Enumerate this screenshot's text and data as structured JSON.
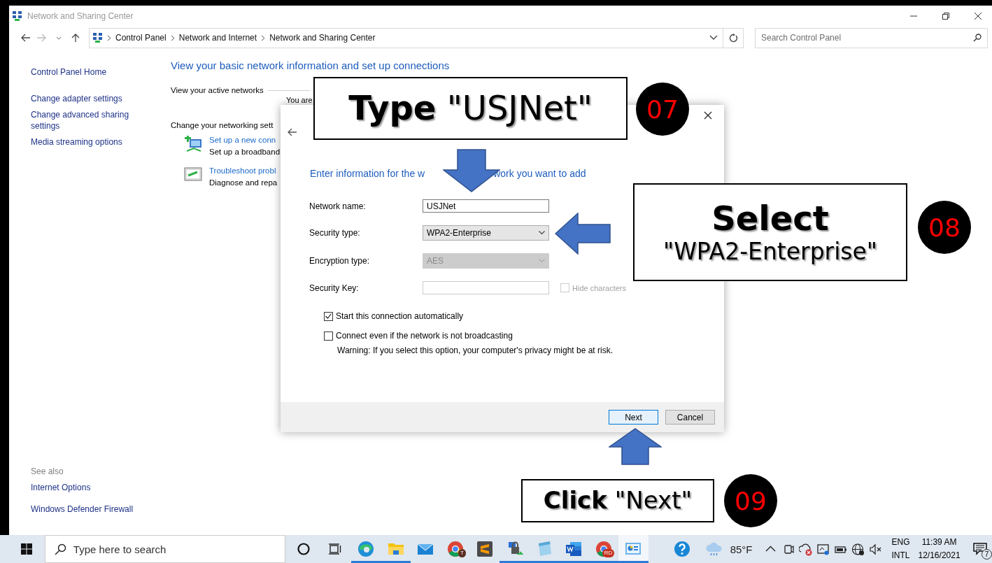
{
  "window": {
    "title": "Network and Sharing Center"
  },
  "address_bar": {
    "breadcrumbs": [
      "Control Panel",
      "Network and Internet",
      "Network and Sharing Center"
    ]
  },
  "search": {
    "placeholder": "Search Control Panel"
  },
  "sidebar": {
    "links": [
      "Control Panel Home",
      "Change adapter settings",
      "Change advanced sharing settings",
      "Media streaming options"
    ],
    "see_also_title": "See also",
    "see_also_links": [
      "Internet Options",
      "Windows Defender Firewall"
    ]
  },
  "main": {
    "heading": "View your basic network information and set up connections",
    "active_networks_label": "View your active networks",
    "active_network_text": "You are",
    "change_settings_label": "Change your networking sett",
    "tasks": [
      {
        "kind": "setup",
        "link": "Set up a new conn",
        "description": "Set up a broadband"
      },
      {
        "kind": "troubleshoot",
        "link": "Troubleshoot probl",
        "description": "Diagnose and repa"
      }
    ]
  },
  "dialog": {
    "heading_parts": [
      "Enter information for the w",
      "work you want to add"
    ],
    "fields": [
      {
        "kind": "text",
        "label": "Network name:",
        "value": "USJNet"
      },
      {
        "kind": "select",
        "label": "Security type:",
        "value": "WPA2-Enterprise",
        "disabled": false
      },
      {
        "kind": "select",
        "label": "Encryption type:",
        "value": "AES",
        "disabled": true
      },
      {
        "kind": "text",
        "label": "Security Key:",
        "option": {
          "label": "Hide characters",
          "checked": false,
          "disabled": true
        }
      }
    ],
    "options": [
      {
        "label": "Start this connection automatically",
        "checked": true
      },
      {
        "label": "Connect even if the network is not broadcasting",
        "checked": false
      }
    ],
    "warning": "Warning: If you select this option, your computer's privacy might be at risk.",
    "buttons": [
      {
        "label": "Next",
        "default": true
      },
      {
        "label": "Cancel",
        "default": false
      }
    ]
  },
  "annotations": [
    {
      "kind": "callout",
      "lines": [
        {
          "text": "**Type** \"USJNet\"",
          "emphasis": false
        }
      ],
      "step": "07"
    },
    {
      "kind": "arrow-down"
    },
    {
      "kind": "callout",
      "lines": [
        {
          "text": "Select",
          "emphasis": true
        },
        {
          "text": "\"WPA2-Enterprise\"",
          "emphasis": false
        }
      ],
      "step": "08"
    },
    {
      "kind": "arrow-left"
    },
    {
      "kind": "arrow-up"
    },
    {
      "kind": "callout",
      "lines": [
        {
          "text": "**Click** \"Next\"",
          "emphasis": false
        }
      ],
      "step": "09"
    }
  ],
  "taskbar": {
    "search_placeholder": "Type here to search",
    "apps": [
      {
        "kind": "edge",
        "running": true,
        "selected": false
      },
      {
        "kind": "folder",
        "running": true,
        "selected": false
      },
      {
        "kind": "mail",
        "running": false,
        "selected": false
      },
      {
        "kind": "chrome",
        "running": false,
        "selected": false,
        "badge": "T"
      },
      {
        "kind": "sublime",
        "running": false,
        "selected": false
      },
      {
        "kind": "vpn",
        "running": true,
        "selected": false
      },
      {
        "kind": "notepad",
        "running": true,
        "selected": false
      },
      {
        "kind": "word",
        "running": true,
        "selected": false
      },
      {
        "kind": "chrome",
        "running": true,
        "selected": false,
        "badge": "RD"
      },
      {
        "kind": "control-panel",
        "running": true,
        "selected": true
      }
    ],
    "temperature": "85°F",
    "language": [
      "ENG",
      "INTL"
    ],
    "time": "11:39 AM",
    "date": "12/16/2021",
    "notifications": "7"
  }
}
